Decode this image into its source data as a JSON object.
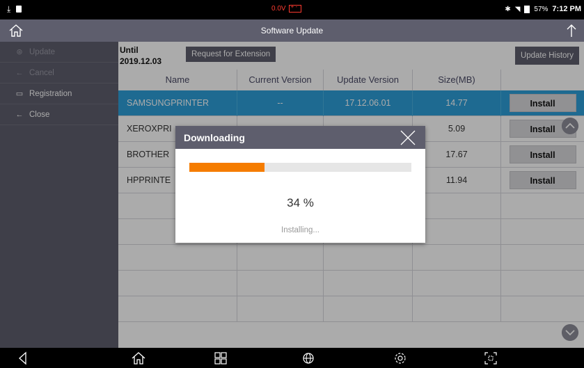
{
  "status_bar": {
    "voltage": "0.0V",
    "battery_percent": "57%",
    "time": "7:12 PM"
  },
  "header": {
    "title": "Software Update"
  },
  "sidebar": {
    "items": [
      {
        "label": "Update",
        "icon": "refresh-icon",
        "enabled": false
      },
      {
        "label": "Cancel",
        "icon": "arrow-left-icon",
        "enabled": false
      },
      {
        "label": "Registration",
        "icon": "registration-icon",
        "enabled": true
      },
      {
        "label": "Close",
        "icon": "arrow-left-icon",
        "enabled": true
      }
    ]
  },
  "toolbar": {
    "until_label": "Until",
    "until_date": "2019.12.03",
    "extension_button": "Request for Extension",
    "history_button": "Update History"
  },
  "table": {
    "columns": [
      "Name",
      "Current Version",
      "Update Version",
      "Size(MB)",
      ""
    ],
    "rows": [
      {
        "name": "SAMSUNGPRINTER",
        "current": "--",
        "update": "17.12.06.01",
        "size": "14.77",
        "action": "Install"
      },
      {
        "name": "XEROXPRI",
        "current": "",
        "update": "",
        "size": "5.09",
        "action": "Install"
      },
      {
        "name": "BROTHER",
        "current": "",
        "update": "",
        "size": "17.67",
        "action": "Install"
      },
      {
        "name": "HPPRINTE",
        "current": "",
        "update": "",
        "size": "11.94",
        "action": "Install"
      }
    ]
  },
  "dialog": {
    "title": "Downloading",
    "progress": 0.34,
    "percent_text": "34 %",
    "status_text": "Installing..."
  },
  "colors": {
    "header_bg": "#5e5e6d",
    "selected_row": "#2e9fd8",
    "progress_fill": "#f57c00"
  }
}
